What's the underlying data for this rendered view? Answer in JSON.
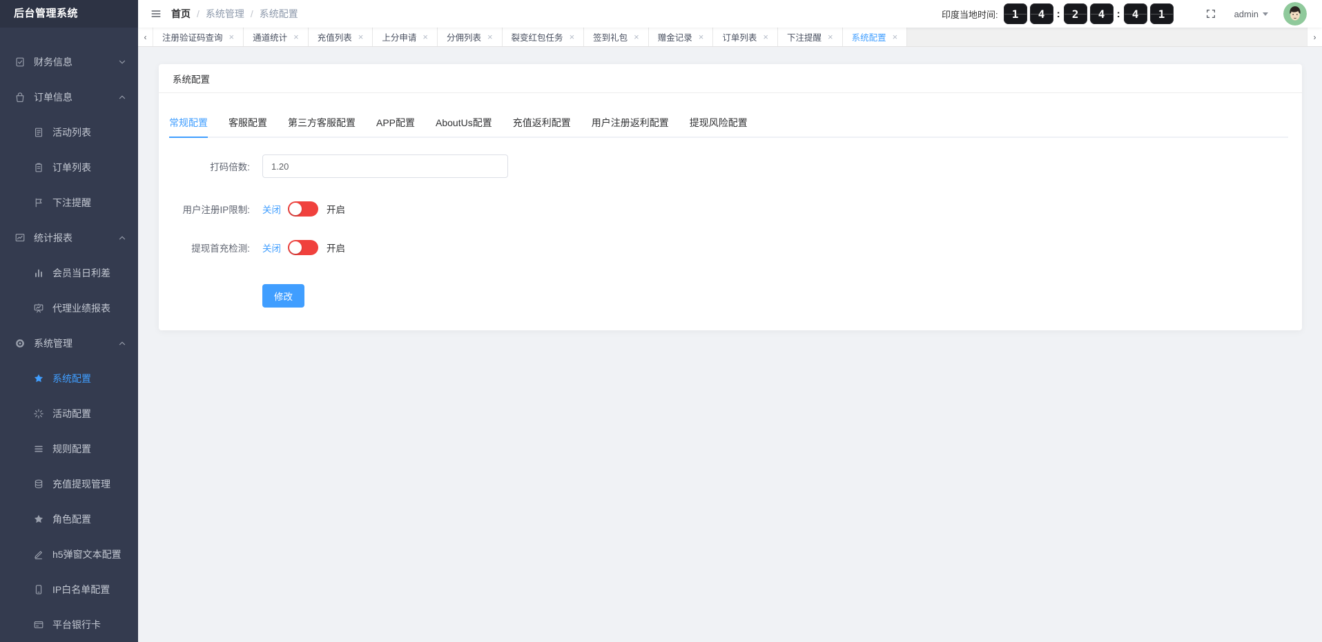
{
  "app": {
    "logo": "后台管理系统"
  },
  "topbar": {
    "breadcrumb": [
      "首页",
      "系统管理",
      "系统配置"
    ],
    "time_label": "印度当地时间:",
    "clock": {
      "digits": [
        "1",
        "4",
        "2",
        "4",
        "4",
        "1"
      ],
      "separator": ":"
    },
    "user": "admin"
  },
  "tags_view": {
    "prev_icon": "‹",
    "next_icon": "›",
    "close_icon": "×",
    "tabs": [
      {
        "label": "注册验证码查询",
        "active": false
      },
      {
        "label": "通道统计",
        "active": false
      },
      {
        "label": "充值列表",
        "active": false
      },
      {
        "label": "上分申请",
        "active": false
      },
      {
        "label": "分佣列表",
        "active": false
      },
      {
        "label": "裂变红包任务",
        "active": false
      },
      {
        "label": "签到礼包",
        "active": false
      },
      {
        "label": "赠金记录",
        "active": false
      },
      {
        "label": "订单列表",
        "active": false
      },
      {
        "label": "下注提醒",
        "active": false
      },
      {
        "label": "系统配置",
        "active": true
      }
    ]
  },
  "sidebar": {
    "items": [
      {
        "label": "财务信息",
        "icon": "finance",
        "level": 1,
        "expandable": true,
        "expanded": false,
        "active": false
      },
      {
        "label": "订单信息",
        "icon": "order-info",
        "level": 1,
        "expandable": true,
        "expanded": true,
        "active": false
      },
      {
        "label": "活动列表",
        "icon": "activity-list",
        "level": 2,
        "active": false
      },
      {
        "label": "订单列表",
        "icon": "order-list",
        "level": 2,
        "active": false
      },
      {
        "label": "下注提醒",
        "icon": "bet-reminder",
        "level": 2,
        "active": false
      },
      {
        "label": "统计报表",
        "icon": "stats-report",
        "level": 1,
        "expandable": true,
        "expanded": true,
        "active": false
      },
      {
        "label": "会员当日利差",
        "icon": "member-daily-margin",
        "level": 2,
        "active": false
      },
      {
        "label": "代理业绩报表",
        "icon": "agent-performance",
        "level": 2,
        "active": false
      },
      {
        "label": "系统管理",
        "icon": "system-management",
        "level": 1,
        "expandable": true,
        "expanded": true,
        "active": false
      },
      {
        "label": "系统配置",
        "icon": "system-config",
        "level": 2,
        "active": true
      },
      {
        "label": "活动配置",
        "icon": "activity-config",
        "level": 2,
        "active": false
      },
      {
        "label": "规则配置",
        "icon": "rule-config",
        "level": 2,
        "active": false
      },
      {
        "label": "充值提现管理",
        "icon": "recharge-withdraw",
        "level": 2,
        "active": false
      },
      {
        "label": "角色配置",
        "icon": "role-config",
        "level": 2,
        "active": false
      },
      {
        "label": "h5弹窗文本配置",
        "icon": "h5-popup-text",
        "level": 2,
        "active": false
      },
      {
        "label": "IP白名单配置",
        "icon": "ip-whitelist",
        "level": 2,
        "active": false
      },
      {
        "label": "平台银行卡",
        "icon": "platform-bankcard",
        "level": 2,
        "active": false
      }
    ]
  },
  "main": {
    "card_title": "系统配置",
    "tabs": [
      {
        "label": "常规配置",
        "active": true
      },
      {
        "label": "客服配置",
        "active": false
      },
      {
        "label": "第三方客服配置",
        "active": false
      },
      {
        "label": "APP配置",
        "active": false
      },
      {
        "label": "AboutUs配置",
        "active": false
      },
      {
        "label": "充值返利配置",
        "active": false
      },
      {
        "label": "用户注册返利配置",
        "active": false
      },
      {
        "label": "提现风险配置",
        "active": false
      }
    ],
    "form": {
      "rows": [
        {
          "type": "input",
          "label": "打码倍数:",
          "value": "1.20"
        },
        {
          "type": "switch",
          "label": "用户注册IP限制:",
          "off_text": "关闭",
          "on_text": "开启",
          "state": "off"
        },
        {
          "type": "switch",
          "label": "提现首充检测:",
          "off_text": "关闭",
          "on_text": "开启",
          "state": "off"
        }
      ],
      "submit_label": "修改"
    }
  },
  "colors": {
    "accent": "#409eff",
    "switch_red": "#f0413d",
    "sidebar_bg": "#343b4f",
    "clock_tile_bg": "#17181c",
    "page_bg": "#f0f2f5"
  }
}
